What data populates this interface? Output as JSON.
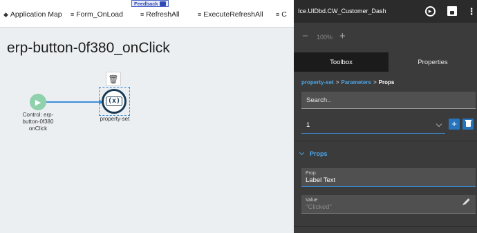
{
  "tabs": [
    {
      "icon": "map-icon",
      "label": "Application Map"
    },
    {
      "icon": "stack-icon",
      "label": "Form_OnLoad"
    },
    {
      "icon": "stack-icon",
      "label": "RefreshAll"
    },
    {
      "icon": "stack-icon",
      "label": "ExecuteRefreshAll"
    },
    {
      "icon": "stack-icon",
      "label": "C"
    }
  ],
  "feedback_label": "Feedback",
  "canvas": {
    "title": "erp-button-0f380_onClick",
    "start_node_label": "Control: erp-button-0f380 onClick",
    "action_node_symbol": "(x)",
    "action_node_label": "property-set"
  },
  "panel": {
    "title": "Ice.UIDbd.CW_Customer_Dash",
    "zoom": {
      "minus": "−",
      "value": "100%",
      "plus": "+"
    },
    "tabs": {
      "toolbox": "Toolbox",
      "properties": "Properties"
    },
    "active_tab": "Toolbox",
    "breadcrumb": {
      "first": "property-set",
      "second": "Parameters",
      "current": "Props",
      "separator": ">"
    },
    "search_placeholder": "Search..",
    "select_value": "1",
    "add_label": "+",
    "section_title": "Props",
    "prop_field": {
      "label": "Prop",
      "value": "Label Text"
    },
    "value_field": {
      "label": "Value",
      "value": "\"Clicked\""
    }
  },
  "colors": {
    "accent": "#4da6e8",
    "button_blue": "#2674bd",
    "panel_bg": "#3b3b3b",
    "node_dark": "#173a54",
    "start_green": "#8fd0ad"
  }
}
